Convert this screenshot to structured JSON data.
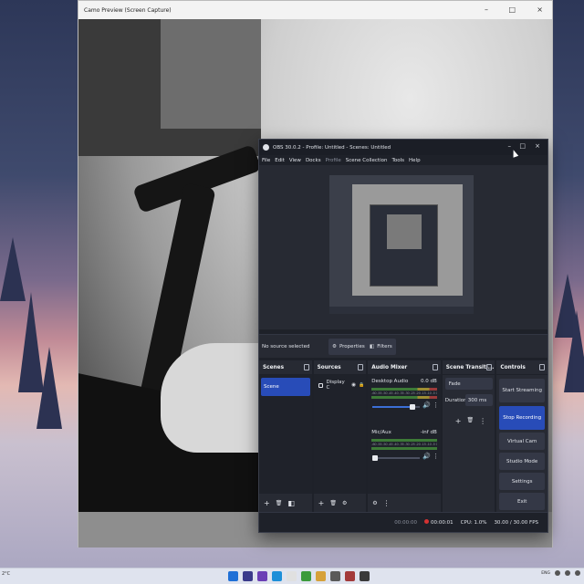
{
  "taskbar": {
    "left_text": "2°C",
    "lang": "ENG",
    "app_colors": [
      "#1f6fd6",
      "#3a3a8a",
      "#6b3fb5",
      "#1d8fd8",
      "#e0e0e0",
      "#3c9b3c",
      "#d6a13a",
      "#5a5a5a",
      "#a33a3a",
      "#3a3a3a"
    ]
  },
  "camo": {
    "title": "Camo Preview (Screen Capture)",
    "minimize_icon": "–",
    "maximize_icon": "□",
    "close_icon": "×"
  },
  "obs": {
    "title": "OBS 30.0.2 - Profile: Untitled - Scenes: Untitled",
    "menu": [
      "File",
      "Edit",
      "View",
      "Docks",
      "Profile",
      "Scene Collection",
      "Tools",
      "Help"
    ],
    "no_source": "No source selected",
    "properties_label": "Properties",
    "filters_label": "Filters",
    "docks": {
      "scenes": {
        "title": "Scenes",
        "items": [
          "Scene"
        ]
      },
      "sources": {
        "title": "Sources",
        "items": [
          "Display C"
        ]
      },
      "mixer": {
        "title": "Audio Mixer",
        "channels": [
          {
            "name": "Desktop Audio",
            "db": "0.0 dB",
            "level": 0.85
          },
          {
            "name": "Mic/Aux",
            "db": "-inf dB",
            "level": 0.05
          }
        ],
        "ticks": "-60 -55 -50 -45 -40 -35 -30 -25 -20 -15 -10 -5 0"
      },
      "transitions": {
        "title": "Scene Transiti...",
        "selected": "Fade",
        "duration_label": "Duration",
        "duration": "300 ms"
      },
      "controls": {
        "title": "Controls",
        "buttons": [
          "Start Streaming",
          "Stop Recording",
          "Virtual Cam",
          "Studio Mode",
          "Settings",
          "Exit"
        ]
      }
    },
    "status": {
      "stream_time": "00:00:00",
      "rec_time": "00:00:01",
      "cpu": "CPU: 1.0%",
      "fps": "30.00 / 30.00 FPS"
    }
  },
  "icons": {
    "add": "+",
    "trash": "🗑",
    "filter": "◧",
    "menu_dots": "⋮",
    "gear": "⚙",
    "up": "⌃",
    "down": "⌄",
    "speaker": "🔊",
    "lock": "🔒",
    "eye": "◉"
  },
  "colors": {
    "accent": "#284cb8",
    "record": "#d43232"
  }
}
